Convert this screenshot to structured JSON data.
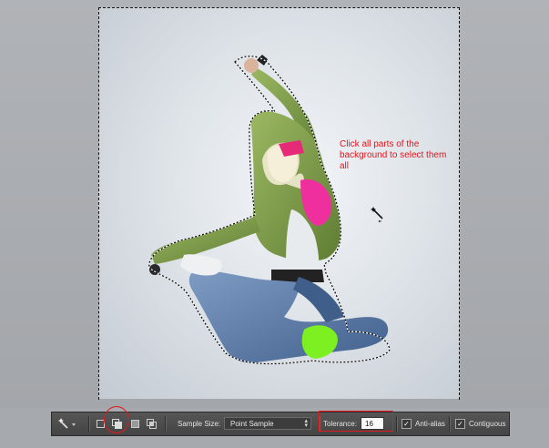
{
  "canvas": {
    "annotation": "Click all parts of the background to select them all"
  },
  "options_bar": {
    "tool_icon": "magic-wand-icon",
    "modes": [
      {
        "name": "new-selection",
        "icon": "new-selection-icon"
      },
      {
        "name": "add-to-selection",
        "icon": "add-to-selection-icon",
        "highlighted": true
      },
      {
        "name": "subtract-from-selection",
        "icon": "subtract-selection-icon"
      },
      {
        "name": "intersect-selection",
        "icon": "intersect-selection-icon"
      }
    ],
    "sample_size_label": "Sample Size:",
    "sample_size_value": "Point Sample",
    "tolerance_label": "Tolerance:",
    "tolerance_value": "16",
    "anti_alias_label": "Anti-alias",
    "anti_alias_checked": true,
    "contiguous_label": "Contiguous",
    "contiguous_checked": true
  },
  "colors": {
    "callout": "#e21a1a",
    "annotation_text": "#e3141b",
    "toolbar_bg": "#4a4a4a"
  }
}
